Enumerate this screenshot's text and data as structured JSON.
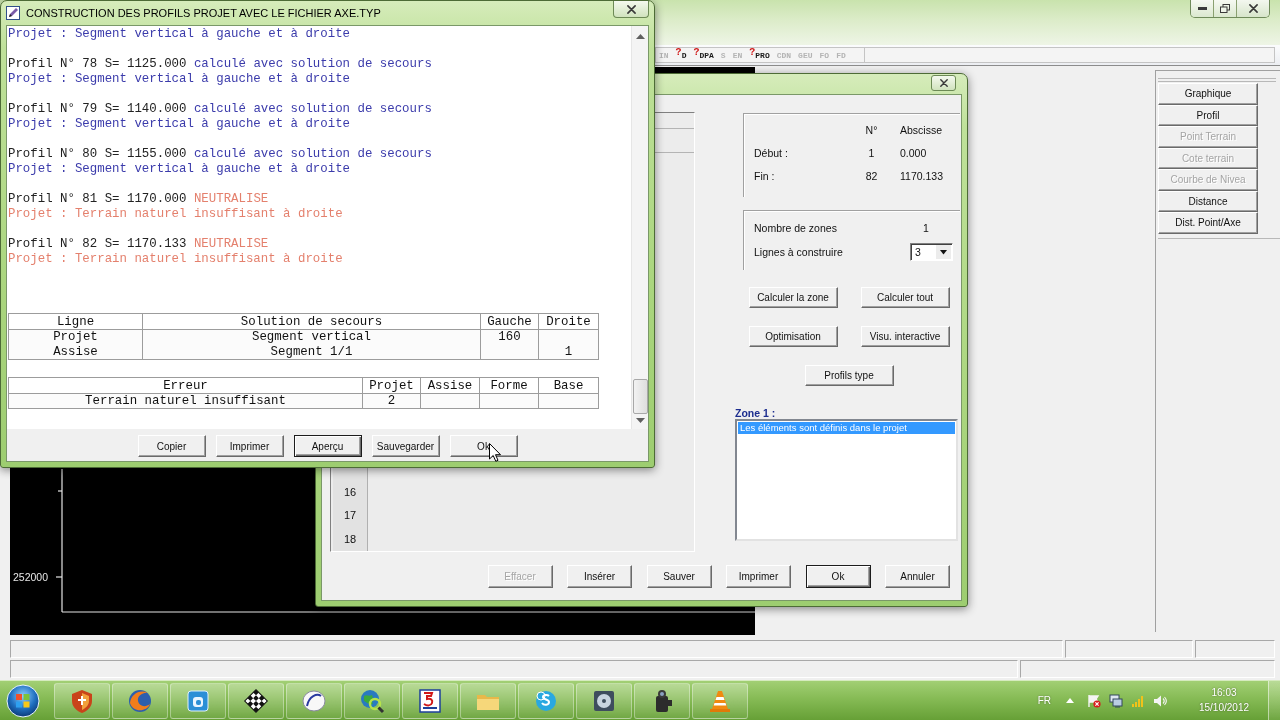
{
  "main_window": {
    "toolbar": [
      {
        "label": "IN",
        "disabled": true
      },
      {
        "label": "D",
        "mark": "?",
        "disabled": false
      },
      {
        "label": "DPA",
        "mark": "?",
        "disabled": false
      },
      {
        "label": "S",
        "disabled": true
      },
      {
        "label": "EN",
        "disabled": true
      },
      {
        "label": "PRO",
        "mark": "?",
        "disabled": false
      },
      {
        "label": "CDN",
        "disabled": true
      },
      {
        "label": "GEU",
        "disabled": true
      },
      {
        "label": "FO",
        "disabled": true
      },
      {
        "label": "FD",
        "disabled": true
      }
    ],
    "plot": {
      "axis_label": "252000"
    },
    "side_buttons": [
      {
        "label": "Graphique",
        "disabled": false
      },
      {
        "label": "Profil",
        "disabled": false
      },
      {
        "label": "Point Terrain",
        "disabled": true
      },
      {
        "label": "Cote terrain",
        "disabled": true
      },
      {
        "label": "Courbe de Nivea",
        "disabled": true
      },
      {
        "label": "Distance",
        "disabled": false
      },
      {
        "label": "Dist. Point/Axe",
        "disabled": false
      }
    ]
  },
  "zone_dialog": {
    "row_numbers": [
      "16",
      "17",
      "18"
    ],
    "range": {
      "columns": [
        "N°",
        "Abscisse"
      ],
      "rows": [
        {
          "label": "Début :",
          "number": "1",
          "abscissa": "0.000"
        },
        {
          "label": "Fin :",
          "number": "82",
          "abscissa": "1170.133"
        }
      ]
    },
    "zone_count": {
      "label": "Nombre de zones",
      "value": "1"
    },
    "lines_to_build": {
      "label": "Lignes à construire",
      "value": "3"
    },
    "actions": [
      "Calculer la zone",
      "Calculer tout",
      "Optimisation",
      "Visu. interactive",
      "Profils type"
    ],
    "zone_label": "Zone 1 :",
    "zone_items": [
      {
        "text": "Les éléments sont définis dans le projet",
        "selected": true
      }
    ],
    "buttons": [
      {
        "label": "Effacer",
        "disabled": true,
        "default": false
      },
      {
        "label": "Insérer",
        "disabled": false,
        "default": false
      },
      {
        "label": "Sauver",
        "disabled": false,
        "default": false
      },
      {
        "label": "Imprimer",
        "disabled": false,
        "default": false
      },
      {
        "label": "Ok",
        "disabled": false,
        "default": true
      },
      {
        "label": "Annuler",
        "disabled": false,
        "default": false
      }
    ]
  },
  "report_dialog": {
    "title": "CONSTRUCTION DES PROFILS PROJET AVEC LE FICHIER AXE.TYP",
    "log": [
      {
        "detail": "Projet : Segment vertical à gauche et à droite",
        "neutralised": false
      },
      {
        "profile": "Profil N° 78 S= 1125.000",
        "status": "calculé avec solution de secours",
        "detail": "Projet : Segment vertical à gauche et à droite",
        "neutralised": false
      },
      {
        "profile": "Profil N° 79 S= 1140.000",
        "status": "calculé avec solution de secours",
        "detail": "Projet : Segment vertical à gauche et à droite",
        "neutralised": false
      },
      {
        "profile": "Profil N° 80 S= 1155.000",
        "status": "calculé avec solution de secours",
        "detail": "Projet : Segment vertical à gauche et à droite",
        "neutralised": false
      },
      {
        "profile": "Profil N° 81 S= 1170.000",
        "status": "NEUTRALISE",
        "detail": "Projet : Terrain naturel insuffisant à droite",
        "neutralised": true
      },
      {
        "profile": "Profil N° 82 S= 1170.133",
        "status": "NEUTRALISE",
        "detail": "Projet : Terrain naturel insuffisant à droite",
        "neutralised": true
      }
    ],
    "rescue_table": {
      "columns": [
        "Ligne",
        "Solution de secours",
        "Gauche",
        "Droite"
      ],
      "rows": [
        [
          "Projet",
          "Segment vertical",
          "160",
          null
        ],
        [
          "Assise",
          "Segment 1/1",
          null,
          "1"
        ]
      ]
    },
    "error_table": {
      "columns": [
        "Erreur",
        "Projet",
        "Assise",
        "Forme",
        "Base"
      ],
      "rows": [
        [
          "Terrain naturel insuffisant",
          "2",
          null,
          null,
          null
        ]
      ]
    },
    "buttons": [
      {
        "label": "Copier",
        "focused": false
      },
      {
        "label": "Imprimer",
        "focused": false
      },
      {
        "label": "Aperçu",
        "focused": true
      },
      {
        "label": "Sauvegarder",
        "focused": false
      },
      {
        "label": "Ok",
        "focused": false
      }
    ]
  },
  "taskbar": {
    "language": "FR",
    "time": "16:03",
    "date": "15/10/2012"
  }
}
